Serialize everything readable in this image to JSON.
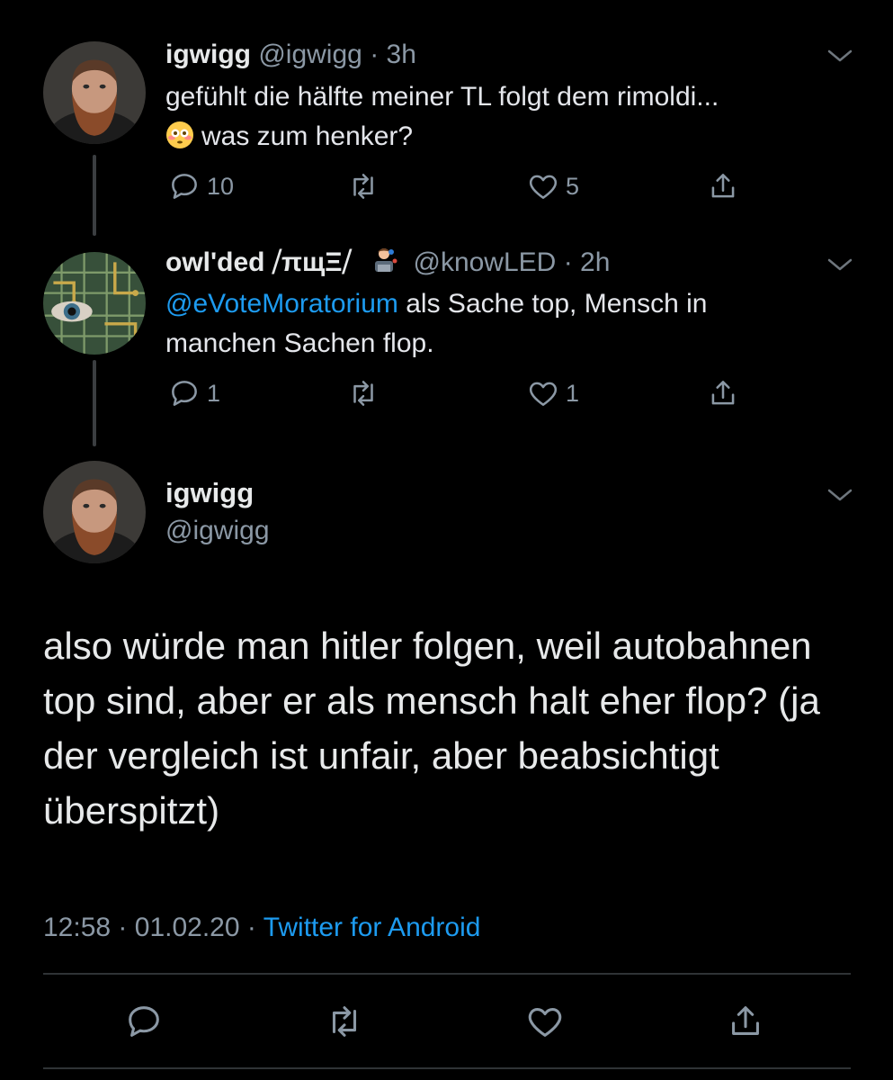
{
  "tweets": [
    {
      "display_name": "igwigg",
      "handle": "@igwigg",
      "separator": "·",
      "time": "3h",
      "emoji": "flushed-face",
      "text_line1": "gefühlt die hälfte meiner TL folgt dem rimoldi...",
      "text_line2": "was zum henker?",
      "reply_count": "10",
      "like_count": "5"
    },
    {
      "display_name": "owl'ded ⧸πщΞ⧸",
      "emoji": "technologist",
      "handle": "@knowLED",
      "separator": "·",
      "time": "2h",
      "mention": "@eVoteMoratorium",
      "text": "als Sache top, Mensch in manchen Sachen flop.",
      "reply_count": "1",
      "like_count": "1"
    }
  ],
  "main_tweet": {
    "display_name": "igwigg",
    "handle": "@igwigg",
    "text": "also würde man hitler folgen, weil autobahnen top sind, aber er als mensch halt eher flop? (ja der vergleich ist unfair, aber beabsichtigt überspitzt)",
    "time": "12:58",
    "date": "01.02.20",
    "separator": "·",
    "source": "Twitter for Android"
  },
  "colors": {
    "background": "#000000",
    "accent": "#1d9bf0",
    "secondary_text": "#8b98a5",
    "divider": "#2f3336"
  },
  "icons": [
    "reply-icon",
    "retweet-icon",
    "like-icon",
    "share-icon",
    "chevron-down-icon"
  ]
}
